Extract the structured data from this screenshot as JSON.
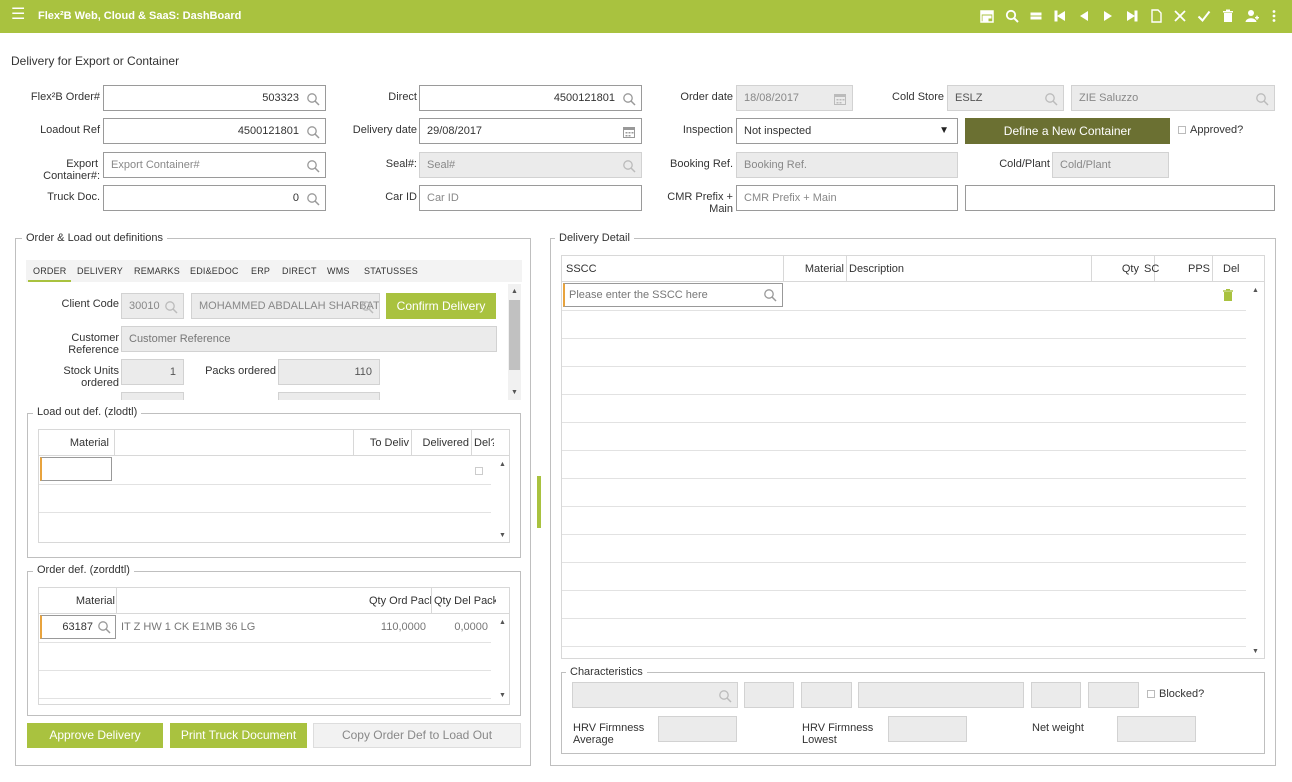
{
  "app": {
    "title": "Flex²B Web, Cloud & SaaS: DashBoard"
  },
  "toolbar_icons": [
    "calendar-icon",
    "search-icon",
    "equals-icon",
    "first-icon",
    "prev-icon",
    "next-icon",
    "last-icon",
    "new-doc-icon",
    "close-icon",
    "check-icon",
    "delete-icon",
    "user-icon",
    "more-icon"
  ],
  "page": {
    "title": "Delivery for Export or Container"
  },
  "header": {
    "order_label": "Flex²B Order#",
    "order_value": "503323",
    "direct_label": "Direct",
    "direct_value": "4500121801",
    "order_date_label": "Order date",
    "order_date_value": "18/08/2017",
    "cold_store_label": "Cold Store",
    "cold_store_code": "ESLZ",
    "cold_store_name": "ZIE Saluzzo",
    "loadout_label": "Loadout Ref",
    "loadout_value": "4500121801",
    "delivery_date_label": "Delivery date",
    "delivery_date_value": "29/08/2017",
    "inspection_label": "Inspection",
    "inspection_value": "Not inspected",
    "define_container_button": "Define a New Container",
    "approved_label": "Approved?",
    "export_label_1": "Export",
    "export_label_2": "Container#:",
    "export_placeholder": "Export Container#",
    "seal_label": "Seal#:",
    "seal_placeholder": "Seal#",
    "booking_label": "Booking Ref.",
    "booking_placeholder": "Booking Ref.",
    "cold_plant_label": "Cold/Plant",
    "cold_plant_placeholder": "Cold/Plant",
    "truck_label": "Truck Doc.",
    "truck_value": "0",
    "car_label": "Car ID",
    "car_placeholder": "Car ID",
    "cmr_label_1": "CMR Prefix +",
    "cmr_label_2": "Main",
    "cmr_placeholder": "CMR Prefix + Main"
  },
  "left_panel": {
    "legend": "Order & Load out definitions",
    "tabs": [
      "ORDER",
      "DELIVERY",
      "REMARKS",
      "EDI&EDOC",
      "ERP",
      "DIRECT",
      "WMS",
      "STATUSSES"
    ],
    "client_code_label": "Client Code",
    "client_code_value": "30010",
    "client_name_value": "MOHAMMED ABDALLAH SHARBATLY",
    "confirm_button": "Confirm Delivery",
    "customer_ref_label_1": "Customer",
    "customer_ref_label_2": "Reference",
    "customer_ref_placeholder": "Customer Reference",
    "stock_units_label_1": "Stock Units",
    "stock_units_label_2": "ordered",
    "stock_units_value": "1",
    "packs_ordered_label": "Packs ordered",
    "packs_ordered_value": "110",
    "loadout_def": {
      "legend": "Load out def. (zlodtl)",
      "columns": [
        "Material",
        "To Deliv",
        "Delivered",
        "Del?"
      ]
    },
    "order_def": {
      "legend": "Order def. (zorddtl)",
      "columns": [
        "Material",
        "Qty Ord Pack",
        "Qty Del Pack"
      ],
      "rows": [
        {
          "material": "63187",
          "description": "IT Z HW 1 CK E1MB 36 LG",
          "qty_ord": "110,0000",
          "qty_del": "0,0000"
        }
      ]
    },
    "buttons": {
      "approve": "Approve Delivery",
      "print": "Print Truck Document",
      "copy": "Copy Order Def to Load Out"
    }
  },
  "right_panel": {
    "legend": "Delivery Detail",
    "columns": [
      "SSCC",
      "Material",
      "Description",
      "Qty",
      "SC",
      "PPS",
      "Del"
    ],
    "sscc_placeholder": "Please enter the SSCC here",
    "characteristics": {
      "legend": "Characteristics",
      "blocked_label": "Blocked?",
      "hrv_avg_label_1": "HRV Firmness",
      "hrv_avg_label_2": "Average",
      "hrv_low_label_1": "HRV Firmness",
      "hrv_low_label_2": "Lowest",
      "net_weight_label": "Net weight"
    }
  },
  "colors": {
    "brand": "#a9c23f",
    "dark_button": "#6b7032"
  }
}
